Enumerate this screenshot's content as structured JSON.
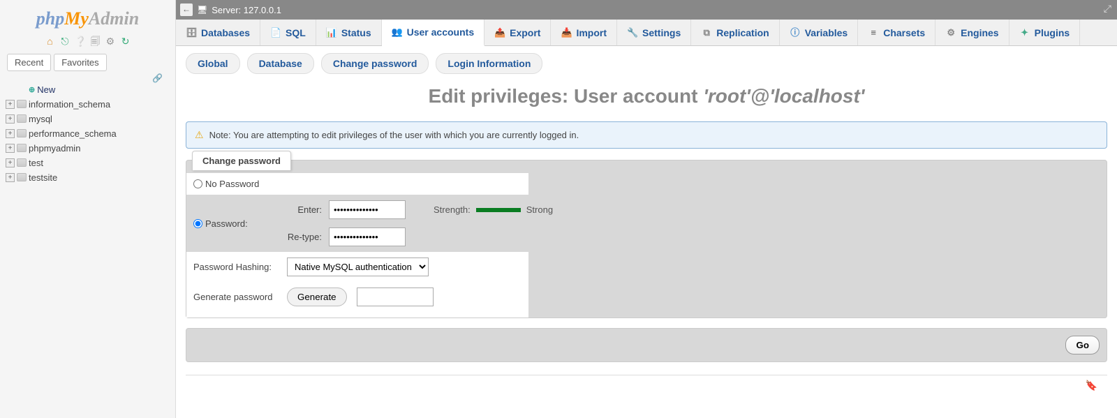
{
  "logo": {
    "part1": "php",
    "part2": "My",
    "part3": "Admin"
  },
  "sidebar_tabs": {
    "recent": "Recent",
    "favorites": "Favorites"
  },
  "tree": {
    "new": "New",
    "items": [
      "information_schema",
      "mysql",
      "performance_schema",
      "phpmyadmin",
      "test",
      "testsite"
    ]
  },
  "server_bar": {
    "label": "Server: 127.0.0.1"
  },
  "topnav": [
    {
      "label": "Databases",
      "icon": "database-icon",
      "icls": "ic-db",
      "glyph": "🗄"
    },
    {
      "label": "SQL",
      "icon": "sql-icon",
      "icls": "ic-sql",
      "glyph": "📄"
    },
    {
      "label": "Status",
      "icon": "status-icon",
      "icls": "ic-status",
      "glyph": "📊"
    },
    {
      "label": "User accounts",
      "icon": "user-accounts-icon",
      "icls": "ic-user",
      "glyph": "👥",
      "active": true
    },
    {
      "label": "Export",
      "icon": "export-icon",
      "icls": "ic-export",
      "glyph": "📤"
    },
    {
      "label": "Import",
      "icon": "import-icon",
      "icls": "ic-import",
      "glyph": "📥"
    },
    {
      "label": "Settings",
      "icon": "settings-icon",
      "icls": "ic-settings",
      "glyph": "🔧"
    },
    {
      "label": "Replication",
      "icon": "replication-icon",
      "icls": "ic-rep",
      "glyph": "⧉"
    },
    {
      "label": "Variables",
      "icon": "variables-icon",
      "icls": "ic-var",
      "glyph": "ⓘ"
    },
    {
      "label": "Charsets",
      "icon": "charsets-icon",
      "icls": "ic-char",
      "glyph": "≡"
    },
    {
      "label": "Engines",
      "icon": "engines-icon",
      "icls": "ic-eng",
      "glyph": "⚙"
    },
    {
      "label": "Plugins",
      "icon": "plugins-icon",
      "icls": "ic-plug",
      "glyph": "✦"
    }
  ],
  "subnav": [
    "Global",
    "Database",
    "Change password",
    "Login Information"
  ],
  "heading": {
    "prefix": "Edit privileges: User account ",
    "italic": "'root'@'localhost'"
  },
  "notice": "Note: You are attempting to edit privileges of the user with which you are currently logged in.",
  "form": {
    "legend": "Change password",
    "no_password": "No Password",
    "password": "Password:",
    "enter": "Enter:",
    "retype": "Re-type:",
    "pw_value": "••••••••••••••",
    "strength_label": "Strength:",
    "strength_value": "Strong",
    "hashing_label": "Password Hashing:",
    "hashing_value": "Native MySQL authentication",
    "generate_label": "Generate password",
    "generate_btn": "Generate",
    "go": "Go"
  }
}
